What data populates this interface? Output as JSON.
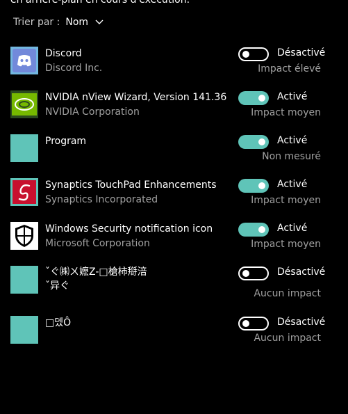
{
  "header": {
    "cut_text": "en arrière-plan en cours d'exécution."
  },
  "sort": {
    "label": "Trier par :",
    "value": "Nom"
  },
  "apps": [
    {
      "name": "Discord",
      "publisher": "Discord Inc.",
      "state": "Désactivé",
      "enabled": false,
      "impact": "Impact élevé",
      "icon": "discord-icon"
    },
    {
      "name": "NVIDIA nView Wizard, Version 141.36",
      "publisher": "NVIDIA Corporation",
      "state": "Activé",
      "enabled": true,
      "impact": "Impact moyen",
      "icon": "nvidia-icon"
    },
    {
      "name": "Program",
      "publisher": "",
      "state": "Activé",
      "enabled": true,
      "impact": "Non mesuré",
      "icon": "generic-app-icon"
    },
    {
      "name": "Synaptics TouchPad Enhancements",
      "publisher": "Synaptics Incorporated",
      "state": "Activé",
      "enabled": true,
      "impact": "Impact moyen",
      "icon": "synaptics-icon"
    },
    {
      "name": "Windows Security notification icon",
      "publisher": "Microsoft Corporation",
      "state": "Activé",
      "enabled": true,
      "impact": "Impact moyen",
      "icon": "shield-icon"
    },
    {
      "name": "ˇぐ㈱ㄨ嬷Z-□槍柿搿涪\nˇ异ぐ",
      "publisher": "",
      "state": "Désactivé",
      "enabled": false,
      "impact": "Aucun impact",
      "icon": "generic-app-icon"
    },
    {
      "name": "□뎄Ô",
      "publisher": "",
      "state": "Désactivé",
      "enabled": false,
      "impact": "Aucun impact",
      "icon": "generic-app-icon"
    }
  ],
  "colors": {
    "accent": "#5fc4b8",
    "background": "#000000",
    "secondary_text": "#a0a0a0"
  }
}
